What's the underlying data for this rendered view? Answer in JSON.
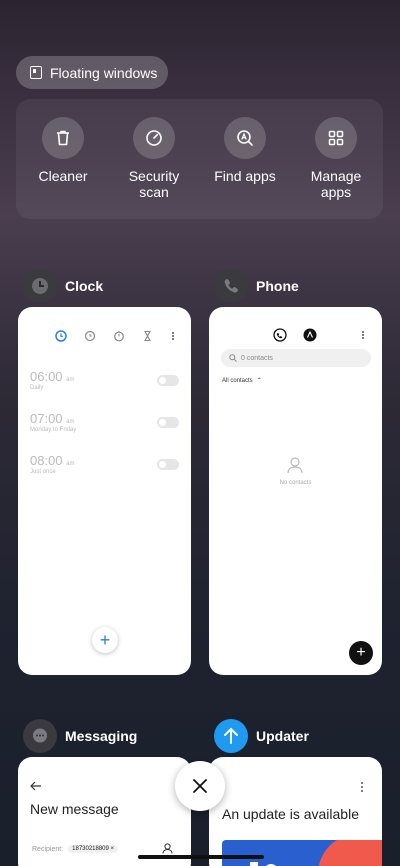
{
  "floating_windows": {
    "label": "Floating windows"
  },
  "tools": [
    {
      "label": "Cleaner",
      "icon": "trash-icon"
    },
    {
      "label": "Security scan",
      "icon": "gauge-icon"
    },
    {
      "label": "Find apps",
      "icon": "search-app-icon"
    },
    {
      "label": "Manage apps",
      "icon": "grid-icon"
    }
  ],
  "apps": {
    "clock": {
      "name": "Clock",
      "alarms": [
        {
          "time": "06:00",
          "ampm": "am",
          "repeat": "Daily"
        },
        {
          "time": "07:00",
          "ampm": "am",
          "repeat": "Monday to Friday"
        },
        {
          "time": "08:00",
          "ampm": "am",
          "repeat": "Just once"
        }
      ]
    },
    "phone": {
      "name": "Phone",
      "search_placeholder": "0 contacts",
      "filter": "All contacts",
      "empty_text": "No contacts"
    },
    "messaging": {
      "name": "Messaging",
      "title": "New message",
      "recipient_label": "Recipient:",
      "recipient_value": "18730218809"
    },
    "updater": {
      "name": "Updater",
      "title": "An update is available"
    }
  },
  "colors": {
    "accent_blue": "#2b7de9",
    "updater_blue": "#1e9bf0",
    "banner_blue": "#2a5fd0",
    "banner_red": "#ef5a4c"
  }
}
